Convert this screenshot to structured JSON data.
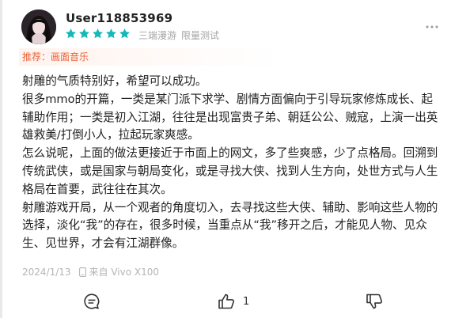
{
  "user": {
    "name": "User118853969",
    "rating": 5,
    "tags": [
      "三端漫游",
      "限量测试"
    ]
  },
  "recommend": {
    "text": "推荐：画面音乐"
  },
  "review": {
    "paragraphs": [
      "射雕的气质特别好，希望可以成功。",
      "很多mmo的开篇，一类是某门派下求学、剧情方面偏向于引导玩家修炼成长、起辅助作用；一类是初入江湖，往往是出现富贵子弟、朝廷公公、贼寇，上演一出英雄救美/打倒小人，拉起玩家爽感。",
      "怎么说呢，上面的做法更接近于市面上的网文，多了些爽感，少了点格局。回溯到传统武侠，或是国家与朝局变化，或是寻找大侠、找到人生方向，处世方式与人生格局在首要，武往往在其次。",
      "射雕游戏开局，从一个观者的角度切入，去寻找这些大侠、辅助、影响这些人物的选择，淡化“我”的存在，很多时候，当重点从“我”移开之后，才能见人物、见众生、见世界，才会有江湖群像。"
    ]
  },
  "footer": {
    "date": "2024/1/13",
    "device": "来自 Vivo X100"
  },
  "actions": {
    "like_count": "1"
  },
  "colors": {
    "star": "#15b8b8",
    "recommend": "#e8623a",
    "meta": "#a6a6a6"
  }
}
